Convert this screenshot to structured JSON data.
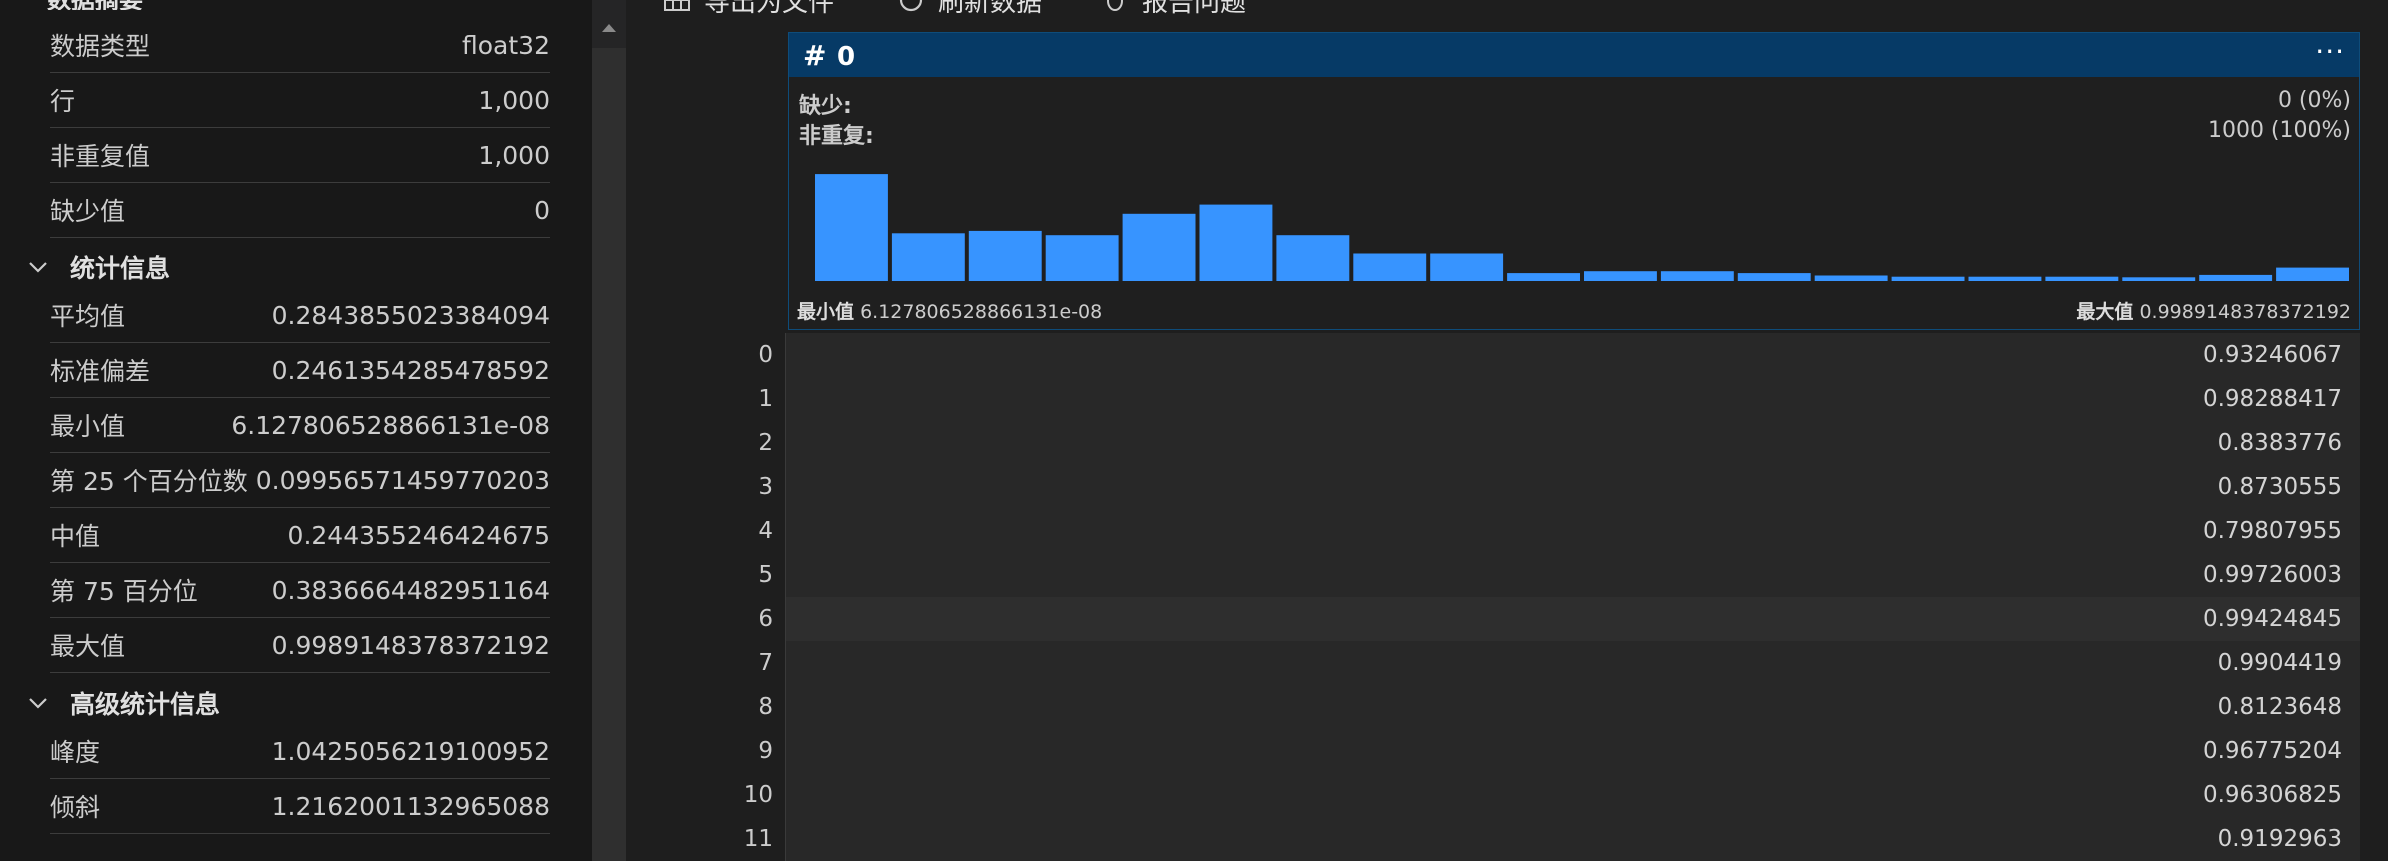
{
  "summary": {
    "header_partial": "数据摘要",
    "rows": [
      {
        "label": "数据类型",
        "value": "float32"
      },
      {
        "label": "行",
        "value": "1,000"
      },
      {
        "label": "非重复值",
        "value": "1,000"
      },
      {
        "label": "缺少值",
        "value": "0"
      }
    ]
  },
  "stats": {
    "title": "统计信息",
    "rows": [
      {
        "label": "平均值",
        "value": "0.2843855023384094"
      },
      {
        "label": "标准偏差",
        "value": "0.2461354285478592"
      },
      {
        "label": "最小值",
        "value": "6.127806528866131e-08"
      },
      {
        "label": "第 25 个百分位数",
        "value": "0.09956571459770203"
      },
      {
        "label": "中值",
        "value": "0.244355246424675"
      },
      {
        "label": "第 75 百分位",
        "value": "0.3836664482951164"
      },
      {
        "label": "最大值",
        "value": "0.9989148378372192"
      }
    ]
  },
  "advanced": {
    "title": "高级统计信息",
    "rows": [
      {
        "label": "峰度",
        "value": "1.0425056219100952"
      },
      {
        "label": "倾斜",
        "value": "1.2162001132965088"
      }
    ]
  },
  "toolbar": {
    "export_label": "导出为文件",
    "refresh_label": "刷新数据",
    "report_label": "报告问题"
  },
  "column": {
    "type_icon": "#",
    "name": "0",
    "more_icon": "···",
    "missing_label": "缺少:",
    "missing_value": "0 (0%)",
    "distinct_label": "非重复:",
    "distinct_value": "1000 (100%)",
    "min_label": "最小值",
    "min_value": "6.127806528866131e-08",
    "max_label": "最大值",
    "max_value": "0.9989148378372192",
    "bar_color": "#3794ff"
  },
  "chart_data": {
    "type": "bar",
    "title": "",
    "values": [
      175,
      78,
      82,
      75,
      110,
      125,
      75,
      45,
      45,
      13,
      16,
      16,
      13,
      9,
      7,
      7,
      7,
      6,
      10,
      22
    ],
    "ylim": [
      0,
      180
    ],
    "grid": false
  },
  "table": {
    "rows": [
      {
        "index": "0",
        "value": "0.93246067"
      },
      {
        "index": "1",
        "value": "0.98288417"
      },
      {
        "index": "2",
        "value": "0.8383776"
      },
      {
        "index": "3",
        "value": "0.8730555"
      },
      {
        "index": "4",
        "value": "0.79807955"
      },
      {
        "index": "5",
        "value": "0.99726003"
      },
      {
        "index": "6",
        "value": "0.99424845"
      },
      {
        "index": "7",
        "value": "0.9904419"
      },
      {
        "index": "8",
        "value": "0.8123648"
      },
      {
        "index": "9",
        "value": "0.96775204"
      },
      {
        "index": "10",
        "value": "0.96306825"
      },
      {
        "index": "11",
        "value": "0.9192963"
      }
    ]
  }
}
